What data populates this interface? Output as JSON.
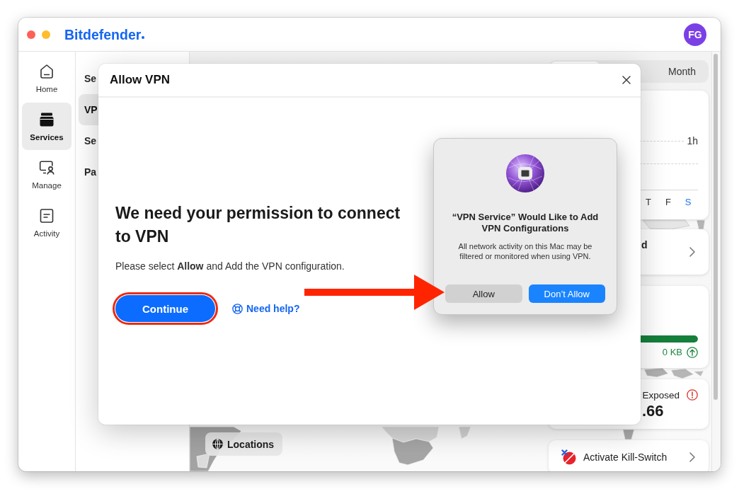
{
  "app": {
    "logo": "Bitdefender",
    "avatar_initials": "FG"
  },
  "sidebar": {
    "items": [
      {
        "label": "Home",
        "selected": false
      },
      {
        "label": "Services",
        "selected": true
      },
      {
        "label": "Manage",
        "selected": false
      },
      {
        "label": "Activity",
        "selected": false
      }
    ]
  },
  "services_menu": {
    "items": [
      {
        "label": "Se",
        "selected": false
      },
      {
        "label": "VP",
        "selected": true
      },
      {
        "label": "Se",
        "selected": false
      },
      {
        "label": "Pa",
        "selected": false
      }
    ]
  },
  "map": {
    "locations_button": "Locations"
  },
  "vpn_panel": {
    "period_tabs": [
      {
        "selected": true
      },
      {
        "label": "Month",
        "selected": false
      }
    ],
    "usage_chart_card": {
      "axis_label": "1h",
      "days": [
        {
          "label": "T",
          "selected": false
        },
        {
          "label": "F",
          "selected": false
        },
        {
          "label": "S",
          "selected": true
        }
      ]
    },
    "status_card": {
      "label": "d"
    },
    "traffic_card": {
      "level": 1,
      "reading": "0 KB"
    },
    "exposure_card": {
      "label": "Exposed",
      "value": ".66"
    },
    "kill_switch_card": {
      "label": "Activate Kill-Switch"
    }
  },
  "dialog": {
    "title": "Allow VPN",
    "heading": "We need your permission to connect to VPN",
    "text": "Please select **Allow** and Add the VPN configuration.",
    "continue_button": {
      "label": "Continue",
      "highlighted": true
    },
    "help_link": "Need help?"
  },
  "system_alert": {
    "title": "“VPN Service” Would Like to Add VPN Configurations",
    "message": "All network activity on this Mac may be filtered or monitored when using VPN.",
    "buttons": [
      {
        "label": "Allow",
        "kind": "secondary"
      },
      {
        "label": "Don’t Allow",
        "kind": "primary"
      }
    ]
  }
}
